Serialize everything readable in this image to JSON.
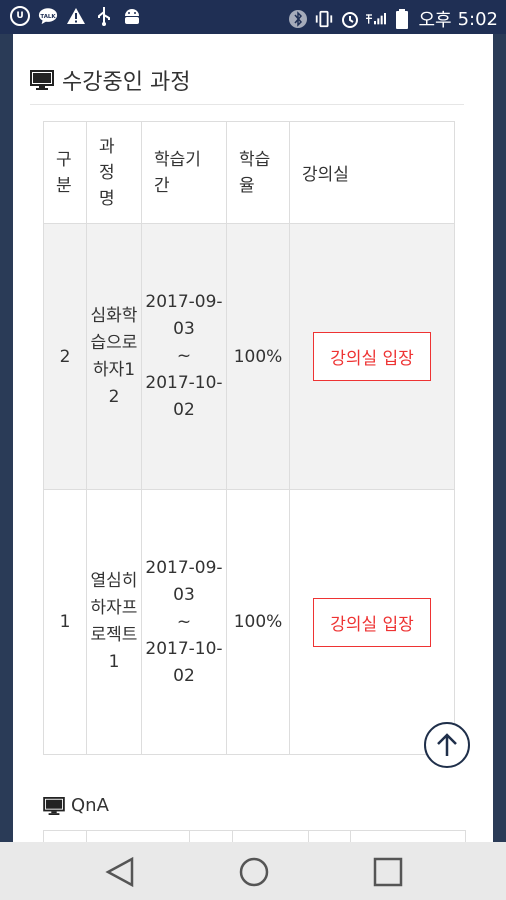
{
  "status_bar": {
    "left_icons": [
      "u-plus-icon",
      "kakaotalk-icon",
      "warning-icon",
      "usb-icon",
      "android-debug-icon"
    ],
    "kakao_text": "TALK",
    "right_icons": [
      "bluetooth-icon",
      "vibrate-icon",
      "alarm-icon",
      "signal-icon",
      "battery-icon"
    ],
    "ampm": "오후",
    "time": "5:02"
  },
  "courses_section": {
    "title": "수강중인 과정",
    "icon": "monitor-icon",
    "headers": [
      "구분",
      "과정명",
      "학습기간",
      "학습율",
      "강의실"
    ],
    "rows": [
      {
        "no": "2",
        "name": "심화학습으로하자12",
        "start": "2017-09-03",
        "tilde": "~",
        "end": "2017-10-02",
        "rate": "100%",
        "button": "강의실 입장"
      },
      {
        "no": "1",
        "name": "열심히하자프로젝트1",
        "start": "2017-09-03",
        "tilde": "~",
        "end": "2017-10-02",
        "rate": "100%",
        "button": "강의실 입장"
      }
    ]
  },
  "qna_section": {
    "title": "QnA",
    "icon": "monitor-icon"
  },
  "scroll_top": {
    "icon": "arrow-up-icon"
  },
  "nav_bar": {
    "icons": [
      "back-icon",
      "home-icon",
      "recents-icon"
    ]
  },
  "colors": {
    "accent_red": "#e33333",
    "status_bar": "#1f2f54",
    "row_shade": "#f2f2f2"
  }
}
